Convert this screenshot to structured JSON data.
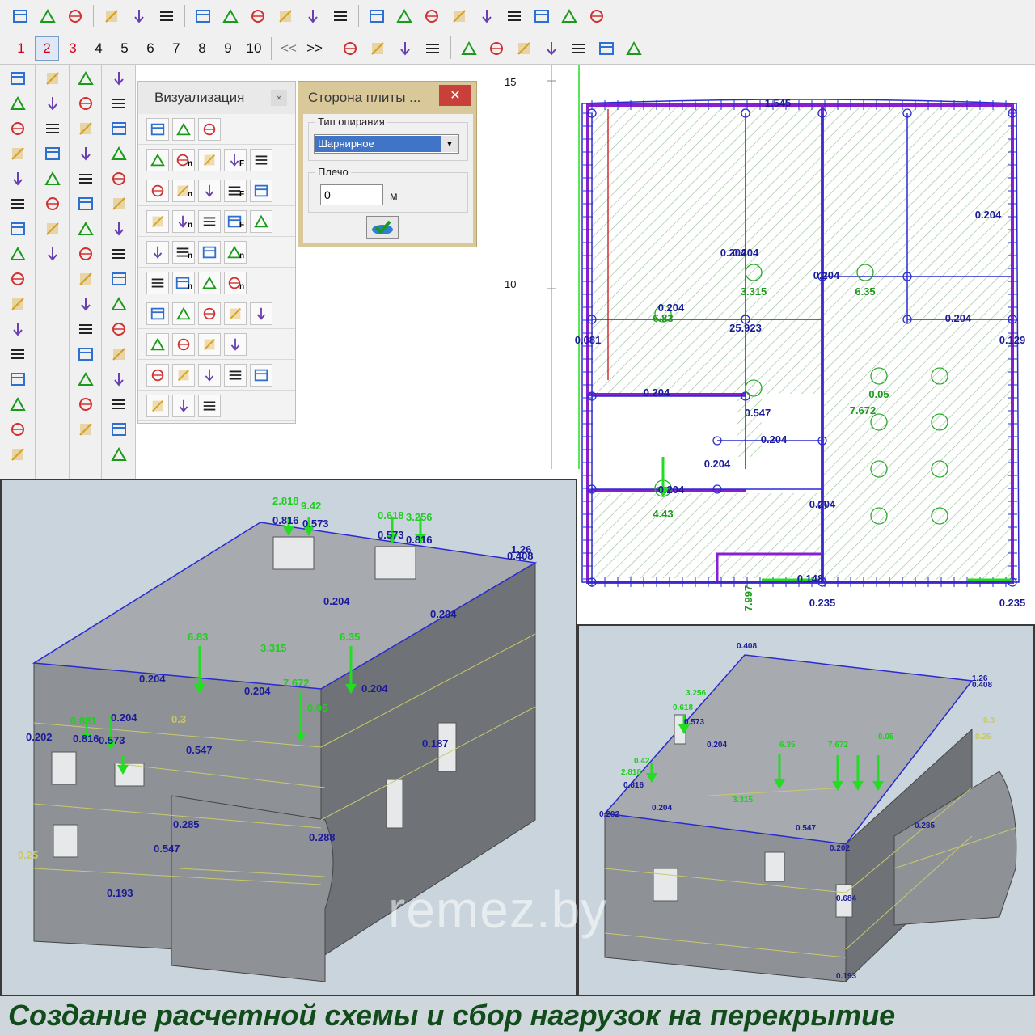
{
  "toolbar_top": {
    "icons": [
      "new-file-icon",
      "open-folder-icon",
      "save-icon",
      "select-frame-icon",
      "hatch-icon",
      "eraser-icon",
      "undo-icon",
      "redo-icon",
      "axes-icon",
      "zoom-out-icon",
      "zoom-in-icon",
      "pencil-icon",
      "layers-icon",
      "grid-icon",
      "snap-icon",
      "pointer-select-icon",
      "node-icon",
      "tree-icon",
      "flag-icon",
      "table-icon",
      "help-icon"
    ]
  },
  "toolbar_steps": {
    "numbers": [
      "1",
      "2",
      "3",
      "4",
      "5",
      "6",
      "7",
      "8",
      "9",
      "10"
    ],
    "active_index": 1,
    "red_numbers": [
      "1",
      "2",
      "3"
    ],
    "prev": "<<",
    "next": ">>"
  },
  "visualization_panel": {
    "title": "Визуализация",
    "close": "×",
    "n_suffix": "n",
    "f_suffix": "F"
  },
  "slab_dialog": {
    "title": "Сторона плиты ...",
    "close": "✕",
    "support_group_label": "Тип опирания",
    "support_value": "Шарнирное",
    "arm_group_label": "Плечо",
    "arm_value": "0",
    "arm_unit": "м"
  },
  "plan": {
    "ruler": [
      "15",
      "10"
    ],
    "labels": [
      {
        "t": "0.204",
        "c": "#1a1a9a"
      },
      {
        "t": "0.204",
        "c": "#1a1a9a"
      },
      {
        "t": "3.315",
        "c": "#1a9a1a"
      },
      {
        "t": "0.204",
        "c": "#1a1a9a"
      },
      {
        "t": "6.35",
        "c": "#1a9a1a"
      },
      {
        "t": "0.204",
        "c": "#1a1a9a"
      },
      {
        "t": "6.83",
        "c": "#1a9a1a"
      },
      {
        "t": "25.923",
        "c": "#1a1a9a"
      },
      {
        "t": "0.081",
        "c": "#1a1a9a"
      },
      {
        "t": "0.204",
        "c": "#1a1a9a"
      },
      {
        "t": "0.129",
        "c": "#1a1a9a"
      },
      {
        "t": "0.204",
        "c": "#1a1a9a"
      },
      {
        "t": "0.547",
        "c": "#1a1a9a"
      },
      {
        "t": "7.672",
        "c": "#1a9a1a"
      },
      {
        "t": "0.204",
        "c": "#1a1a9a"
      },
      {
        "t": "0.204",
        "c": "#1a1a9a"
      },
      {
        "t": "0.204",
        "c": "#1a1a9a"
      },
      {
        "t": "4.43",
        "c": "#1a9a1a"
      },
      {
        "t": "0.204",
        "c": "#1a1a9a"
      },
      {
        "t": "7.997",
        "c": "#1a9a1a"
      },
      {
        "t": "0.148",
        "c": "#1a1a9a"
      },
      {
        "t": "0.235",
        "c": "#1a1a9a"
      },
      {
        "t": "0.235",
        "c": "#1a1a9a"
      },
      {
        "t": "0.05",
        "c": "#1a9a1a"
      },
      {
        "t": "1.545",
        "c": "#1a1a9a"
      },
      {
        "t": "0.204",
        "c": "#1a1a9a"
      }
    ]
  },
  "view_left_labels": [
    "0.202",
    "2.818",
    "9.42",
    "0.816",
    "0.573",
    "0.618",
    "3.256",
    "0.573",
    "0.816",
    "1.26",
    "0.408",
    "0.204",
    "0.204",
    "6.83",
    "3.315",
    "6.35",
    "0.204",
    "0.204",
    "7.672",
    "0.204",
    "0.05",
    "0.881",
    "0.204",
    "0.816",
    "0.573",
    "0.547",
    "0.285",
    "0.547",
    "0.193",
    "0.25",
    "0.3",
    "0.187",
    "0.288"
  ],
  "view_right_labels": [
    "0.408",
    "1.26",
    "0.408",
    "3.256",
    "0.618",
    "0.573",
    "0.42",
    "2.818",
    "0.816",
    "0.202",
    "0.204",
    "0.204",
    "6.35",
    "7.672",
    "0.05",
    "3.315",
    "0.547",
    "0.202",
    "0.285",
    "0.3",
    "0.25",
    "0.193",
    "0.684"
  ],
  "watermark": "remez.by",
  "caption": "Создание расчетной схемы и сбор нагрузок на перекрытие",
  "colors": {
    "wall_purple": "#8a1fd0",
    "axis_blue": "#2a2ad0",
    "load_green": "#22dd22",
    "hatch_green": "#8fbf8f",
    "model_gray": "#8e9296",
    "caption_green": "#114c1a"
  }
}
